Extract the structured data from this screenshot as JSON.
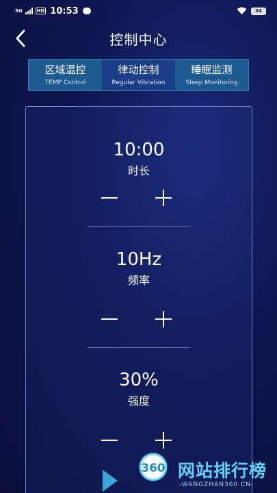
{
  "status_bar": {
    "signal_label": "5G",
    "hd_label": "HD",
    "time": "10:53",
    "battery": "34"
  },
  "header": {
    "title": "控制中心"
  },
  "tabs": [
    {
      "label": "区域温控",
      "sublabel": "TEMP Control",
      "active": false
    },
    {
      "label": "律动控制",
      "sublabel": "Regular Vibration",
      "active": true
    },
    {
      "label": "睡眠监测",
      "sublabel": "Sleep Monitoring",
      "active": false
    }
  ],
  "controls": {
    "duration": {
      "value": "10:00",
      "label": "时长"
    },
    "frequency": {
      "value": "10Hz",
      "label": "频率"
    },
    "intensity": {
      "value": "30%",
      "label": "强度"
    }
  },
  "watermark": {
    "logo_text": "360",
    "site_name": "网站排行榜",
    "site_url": "-WANGZHAN360.CN-"
  },
  "colors": {
    "background": "#0e1650",
    "tab_bar": "#1d5a8f",
    "tab_active": "#1a3d86",
    "panel_border": "#6c86c9",
    "watermark": "#5fd2f5"
  }
}
